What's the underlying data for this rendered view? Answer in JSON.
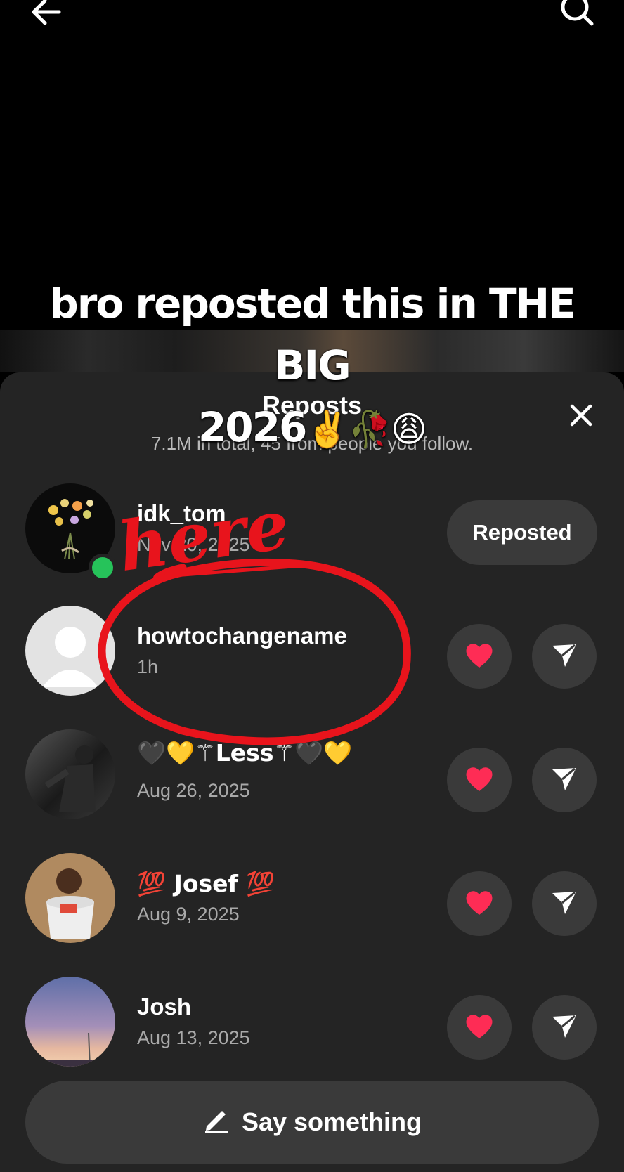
{
  "caption": {
    "line1": "bro reposted this in THE BIG",
    "line2": "2026",
    "emojis": "✌️🥀😩"
  },
  "sheet": {
    "title": "Reposts",
    "subtitle": "7.1M in total, 45 from people you follow."
  },
  "reposts": [
    {
      "name": "idk_tom",
      "date": "Nov 20, 2025",
      "action": "Reposted"
    },
    {
      "name": "howtochangename",
      "date": "1h"
    },
    {
      "name": "🖤💛⚚Less⚚🖤💛",
      "date": "Aug 26, 2025"
    },
    {
      "name": "💯 Josef 💯",
      "date": "Aug 9, 2025"
    },
    {
      "name": "Josh",
      "date": "Aug 13, 2025"
    }
  ],
  "annotation": {
    "text": "here",
    "color": "#e8141c"
  },
  "composer": {
    "label": "Say something"
  },
  "colors": {
    "sheet_bg": "#242424",
    "button_bg": "#3a3a3a",
    "heart": "#fe2c55",
    "online": "#26c35a"
  }
}
